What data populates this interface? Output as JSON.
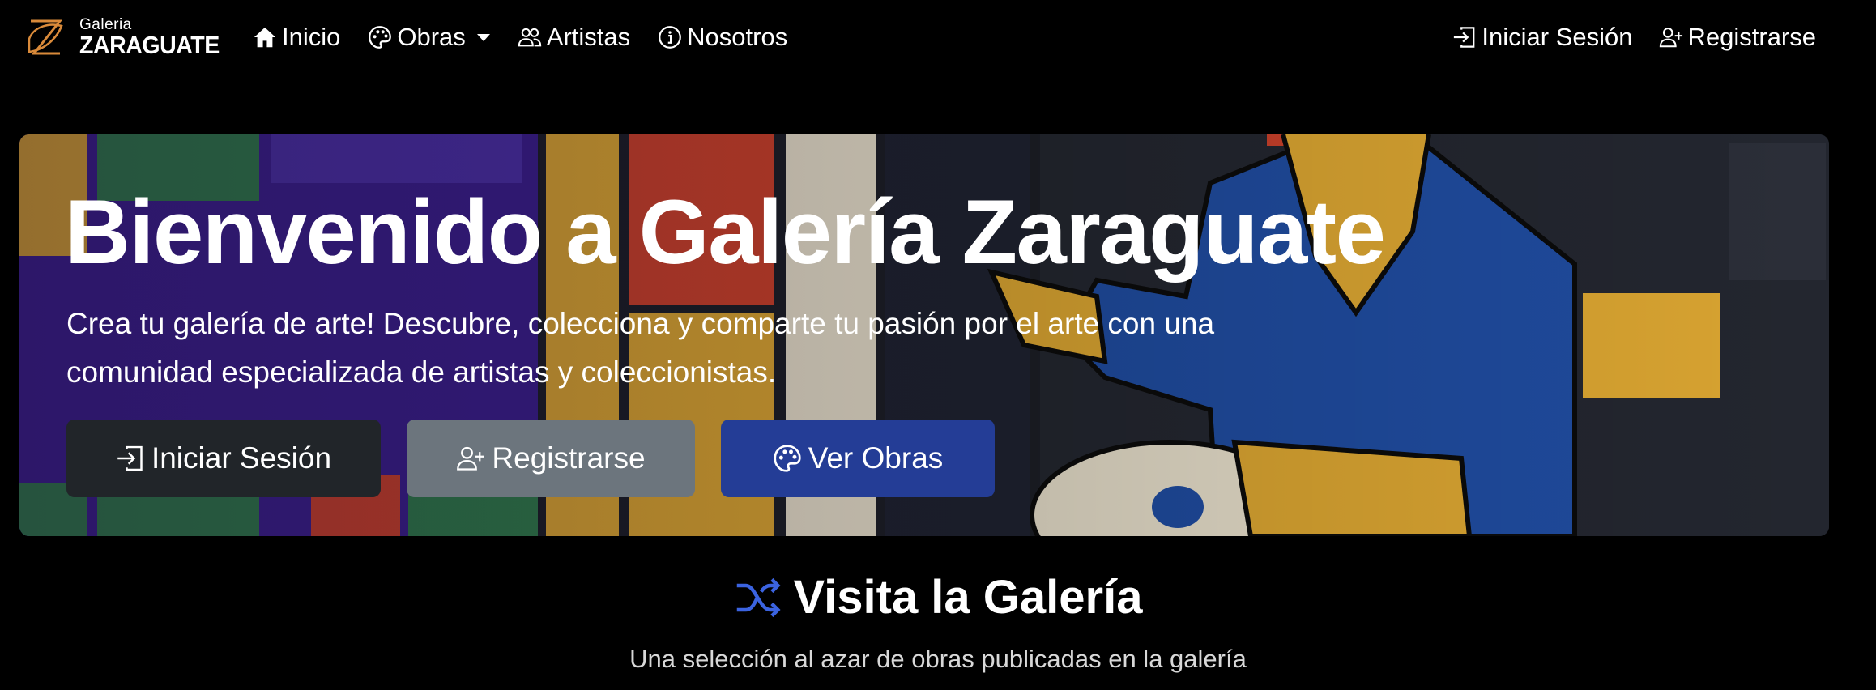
{
  "brand": {
    "small": "Galeria",
    "big": "ZARAGUATE"
  },
  "nav": {
    "inicio": "Inicio",
    "obras": "Obras",
    "artistas": "Artistas",
    "nosotros": "Nosotros",
    "login": "Iniciar Sesión",
    "register": "Registrarse"
  },
  "hero": {
    "title": "Bienvenido a Galería Zaraguate",
    "text": "Crea tu galería de arte! Descubre, colecciona y comparte tu pasión por el arte con una comunidad especializada de artistas y coleccionistas.",
    "btn_login": "Iniciar Sesión",
    "btn_register": "Registrarse",
    "btn_obras": "Ver Obras"
  },
  "section": {
    "title": "Visita la Galería",
    "subtitle": "Una selección al azar de obras publicadas en la galería"
  },
  "colors": {
    "btn_dark": "#212529",
    "btn_gray": "#6c757d",
    "btn_blue": "#243d96",
    "accent_icon": "#3b63e0",
    "logo_orange": "#d98a3a"
  },
  "icons": {
    "inicio": "house-icon",
    "obras": "palette-icon",
    "artistas": "people-icon",
    "nosotros": "info-circle-icon",
    "login": "box-arrow-in-icon",
    "register": "person-plus-icon",
    "section": "shuffle-icon"
  }
}
